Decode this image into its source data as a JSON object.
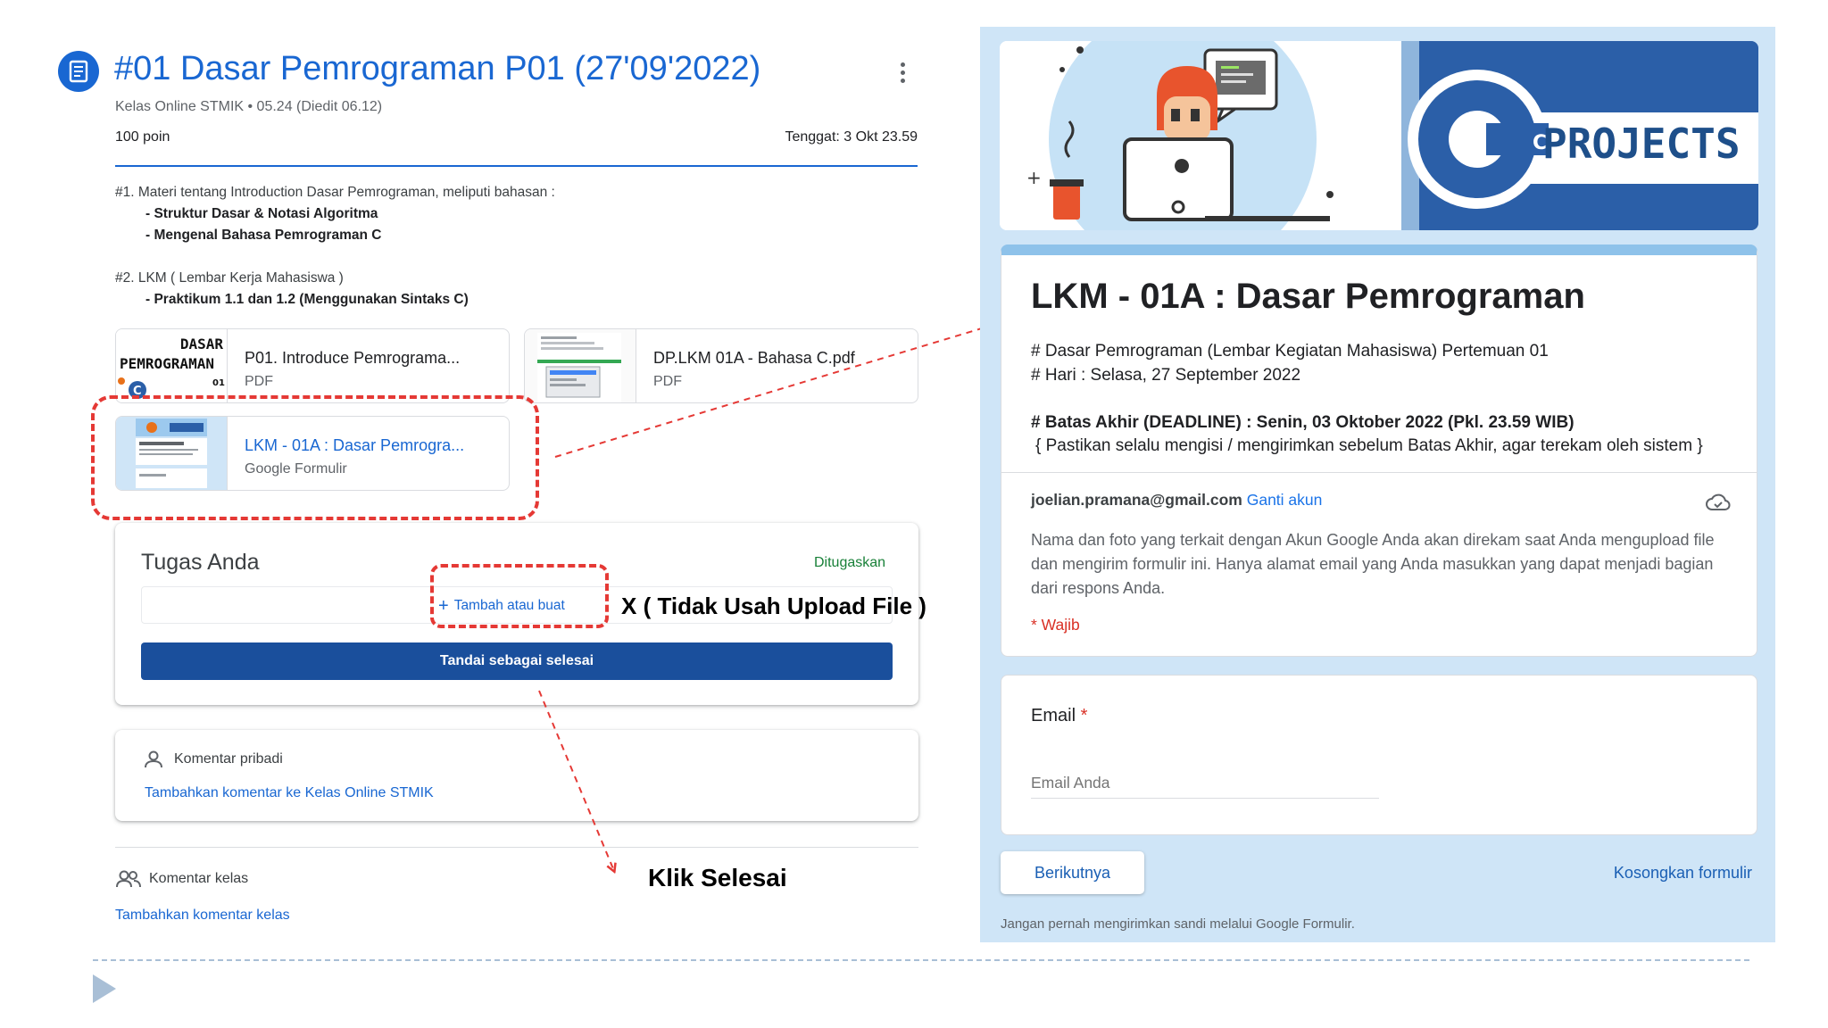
{
  "classroom": {
    "title": "#01 Dasar Pemrograman P01 (27'09'2022)",
    "meta": "Kelas Online STMIK • 05.24 (Diedit 06.12)",
    "points": "100 poin",
    "deadline": "Tenggat: 3 Okt 23.59",
    "description": [
      {
        "text": "#1. Materi tentang Introduction Dasar Pemrograman, meliputi bahasan :",
        "bold": false
      },
      {
        "text": "- Struktur Dasar & Notasi Algoritma",
        "bold": true
      },
      {
        "text": "- Mengenal Bahasa Pemrograman C",
        "bold": true
      },
      {
        "text": "#2. LKM ( Lembar Kerja Mahasiswa )",
        "bold": false
      },
      {
        "text": "- Praktikum 1.1 dan 1.2 (Menggunakan Sintaks C)",
        "bold": true
      }
    ],
    "attachments": [
      {
        "name": "P01. Introduce Pemrograma...",
        "type": "PDF",
        "thumb_title": "DASAR\nPEMROGRAMAN",
        "thumb_num": "01",
        "thumb_icon": "c-logo-icon"
      },
      {
        "name": "DP.LKM 01A - Bahasa C.pdf",
        "type": "PDF",
        "thumb_icon": "document-preview-icon"
      },
      {
        "name": "LKM - 01A : Dasar Pemrogra...",
        "type": "Google Formulir",
        "thumb_icon": "form-preview-icon"
      }
    ],
    "your_work": {
      "title": "Tugas Anda",
      "status": "Ditugaskan",
      "add_label": "Tambah atau buat",
      "done_label": "Tandai sebagai selesai"
    },
    "private_comment": {
      "label": "Komentar pribadi",
      "link": "Tambahkan komentar ke Kelas Online STMIK"
    },
    "class_comment": {
      "label": "Komentar kelas",
      "link": "Tambahkan komentar kelas"
    }
  },
  "annotations": {
    "no_upload": "X ( Tidak Usah Upload File )",
    "click_done": "Klik Selesai",
    "color": "#e53935"
  },
  "form": {
    "banner_text": "PROJECTS",
    "banner_logo": "C++",
    "title": "LKM - 01A : Dasar Pemrograman",
    "desc1": "# Dasar Pemrograman (Lembar Kegiatan Mahasiswa) Pertemuan 01",
    "desc2": "# Hari : Selasa, 27 September 2022",
    "desc3": "# Batas Akhir (DEADLINE) : Senin, 03 Oktober 2022 (Pkl. 23.59 WIB)",
    "desc4": "{ Pastikan selalu mengisi / mengirimkan sebelum Batas Akhir, agar terekam oleh sistem }",
    "account_email": "joelian.pramana@gmail.com",
    "switch_account": "Ganti akun",
    "info": "Nama dan foto yang terkait dengan Akun Google Anda akan direkam saat Anda mengupload file dan mengirim formulir ini. Hanya alamat email yang Anda masukkan yang dapat menjadi bagian dari respons Anda.",
    "required_note": "* Wajib",
    "email_label": "Email",
    "required_star": "*",
    "email_placeholder": "Email Anda",
    "next_label": "Berikutnya",
    "clear_label": "Kosongkan formulir",
    "footer": "Jangan pernah mengirimkan sandi melalui Google Formulir."
  },
  "colors": {
    "classroom_blue": "#1967d2",
    "done_button": "#1a4f9c",
    "form_background": "#cfe5f7",
    "form_accent": "#8ec2ea",
    "assigned_green": "#188038",
    "required_red": "#d93025"
  }
}
